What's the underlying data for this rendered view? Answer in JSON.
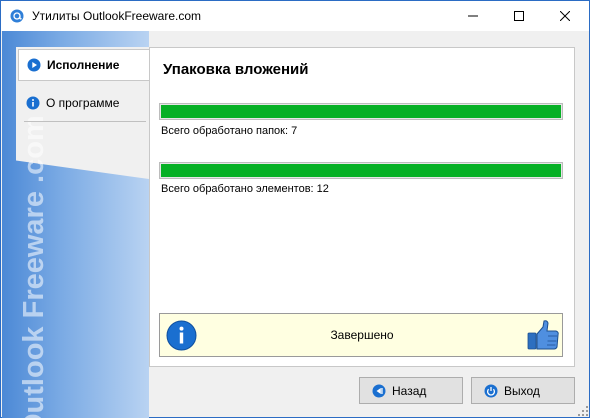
{
  "window": {
    "title": "Утилиты OutlookFreeware.com",
    "controls": [
      "minimize",
      "maximize",
      "close"
    ]
  },
  "sidebar": {
    "brand_text": "Outlook Freeware .com",
    "tabs": [
      {
        "label": "Исполнение",
        "icon": "play-icon",
        "active": true
      },
      {
        "label": "О программе",
        "icon": "info-icon",
        "active": false
      }
    ]
  },
  "main": {
    "heading": "Упаковка вложений",
    "progress": [
      {
        "label": "Всего обработано папок: 7",
        "percent": 100
      },
      {
        "label": "Всего обработано элементов: 12",
        "percent": 100
      }
    ],
    "status": {
      "text": "Завершено",
      "left_icon": "info-icon",
      "right_icon": "thumbs-up-icon"
    }
  },
  "buttons": {
    "back_label": "Назад",
    "exit_label": "Выход"
  },
  "colors": {
    "progress_fill": "#06b025",
    "status_background": "#ffffe1",
    "sidebar_gradient_start": "#4c89d6",
    "icon_blue": "#1a6fd0"
  }
}
